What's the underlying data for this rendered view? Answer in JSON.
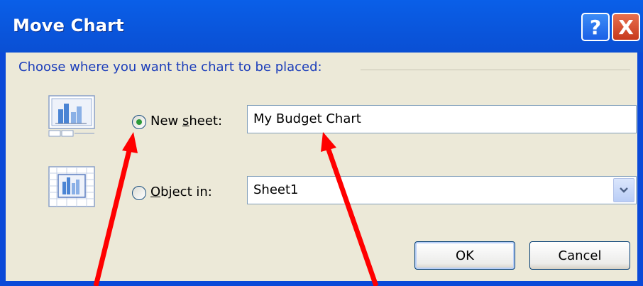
{
  "dialog": {
    "title": "Move Chart",
    "help_label": "?",
    "close_label": "X"
  },
  "group": {
    "label": "Choose where you want the chart to be placed:"
  },
  "new_sheet": {
    "label_prefix": "New ",
    "label_accel": "s",
    "label_suffix": "heet:",
    "value": "My Budget Chart",
    "selected": true
  },
  "object_in": {
    "label_accel": "O",
    "label_suffix": "bject in:",
    "value": "Sheet1",
    "selected": false
  },
  "buttons": {
    "ok": "OK",
    "cancel": "Cancel"
  },
  "colors": {
    "annotation_arrow": "#ff0000",
    "title_bar": "#0a56dc",
    "dialog_bg": "#ece9d8",
    "group_label": "#1b3dba"
  }
}
